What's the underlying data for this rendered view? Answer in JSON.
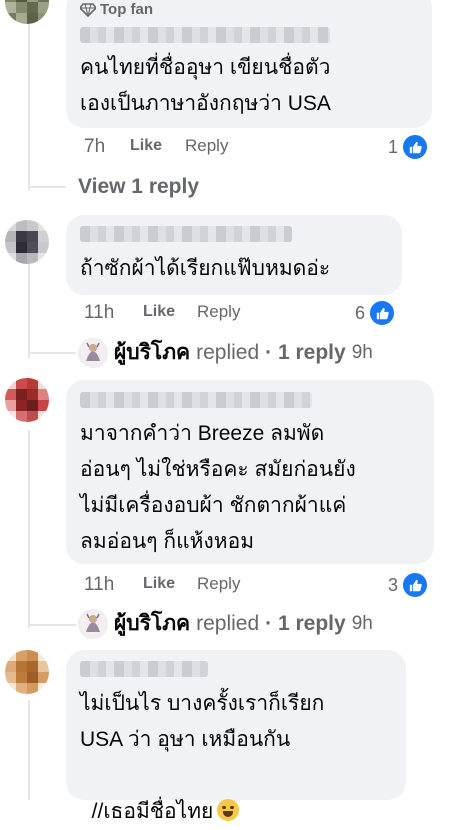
{
  "comments": [
    {
      "badge": "Top fan",
      "lines": [
        "คนไทยที่ชื่ออุษา เขียนชื่อตัว",
        "เองเป็นภาษาอังกฤษว่า USA"
      ],
      "time": "7h",
      "like": "Like",
      "reply": "Reply",
      "reactions": "1",
      "view_replies": "View 1 reply"
    },
    {
      "lines": [
        "ถ้าซักผ้าได้เรียกแฟ๊บหมดอ่ะ"
      ],
      "time": "11h",
      "like": "Like",
      "reply": "Reply",
      "reactions": "6",
      "replied_by": "ผู้บริโภค",
      "replied_text": "replied",
      "reply_count": "· 1 reply",
      "reply_time": "9h"
    },
    {
      "lines": [
        "มาจากคำว่า Breeze ลมพัด",
        "อ่อนๆ ไม่ใช่หรือคะ สมัยก่อนยัง",
        "ไม่มีเครื่องอบผ้า ชักตากผ้าแค่",
        "ลมอ่อนๆ ก็แห้งหอม"
      ],
      "time": "11h",
      "like": "Like",
      "reply": "Reply",
      "reactions": "3",
      "replied_by": "ผู้บริโภค",
      "replied_text": "replied",
      "reply_count": "· 1 reply",
      "reply_time": "9h"
    },
    {
      "lines": [
        "ไม่เป็นไร บางครั้งเราก็เรียก",
        "USA ว่า อุษา เหมือนกัน",
        "//เธอมีชื่อไทย"
      ],
      "emoji": "laughing-face-icon"
    }
  ],
  "colors": {
    "bubble": "#f0f2f5",
    "like_blue": "#1877f2",
    "meta_gray": "#65676b"
  }
}
